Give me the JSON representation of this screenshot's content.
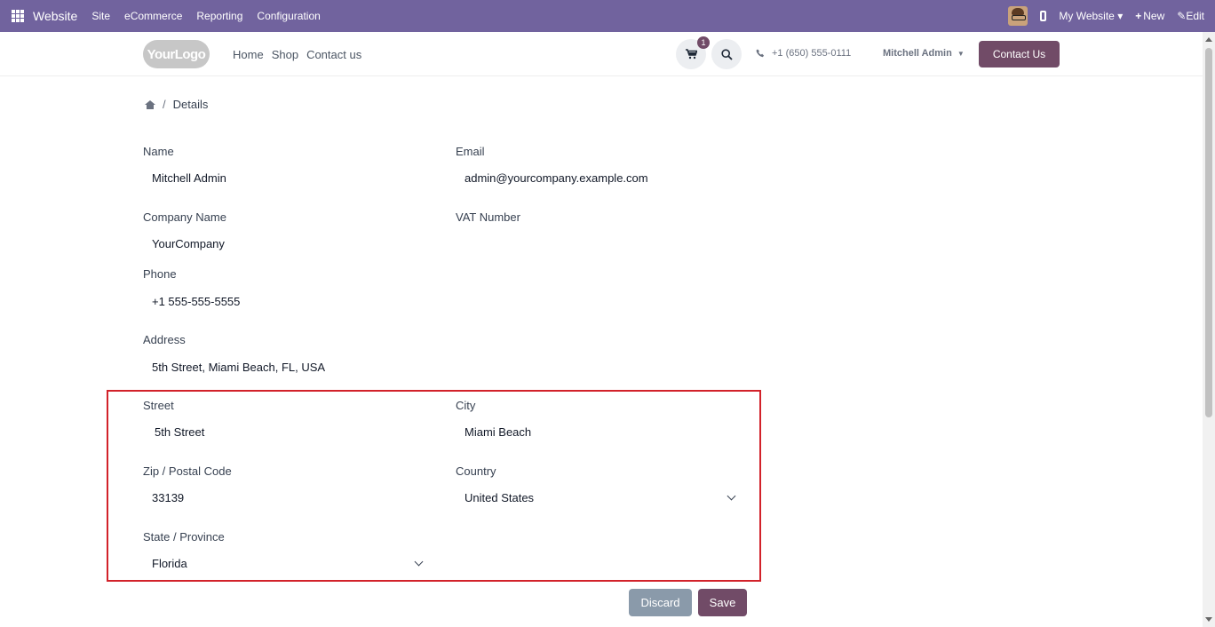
{
  "topbar": {
    "brand": "Website",
    "menu": [
      "Site",
      "eCommerce",
      "Reporting",
      "Configuration"
    ],
    "my_website": "My Website",
    "new_label": "New",
    "edit_label": "Edit"
  },
  "header": {
    "logo_text": "YourLogo",
    "nav": [
      "Home",
      "Shop",
      "Contact us"
    ],
    "cart_count": "1",
    "phone": "+1 (650) 555-0111",
    "user": "Mitchell Admin",
    "contact_button": "Contact Us"
  },
  "breadcrumb": {
    "separator": "/",
    "current": "Details"
  },
  "form": {
    "name_label": "Name",
    "name_value": "Mitchell Admin",
    "email_label": "Email",
    "email_value": "admin@yourcompany.example.com",
    "company_label": "Company Name",
    "company_value": "YourCompany",
    "vat_label": "VAT Number",
    "vat_value": "",
    "phone_label": "Phone",
    "phone_value": "+1 555-555-5555",
    "address_label": "Address",
    "address_value": "5th Street, Miami Beach, FL, USA",
    "street_label": "Street",
    "street_value": "5th Street",
    "city_label": "City",
    "city_value": "Miami Beach",
    "zip_label": "Zip / Postal Code",
    "zip_value": "33139",
    "country_label": "Country",
    "country_value": "United States",
    "state_label": "State / Province",
    "state_value": "Florida"
  },
  "actions": {
    "discard": "Discard",
    "save": "Save"
  },
  "colors": {
    "topbar": "#71639e",
    "primary": "#714b67",
    "highlight": "#d2222a",
    "discard": "#8a9aaa"
  }
}
